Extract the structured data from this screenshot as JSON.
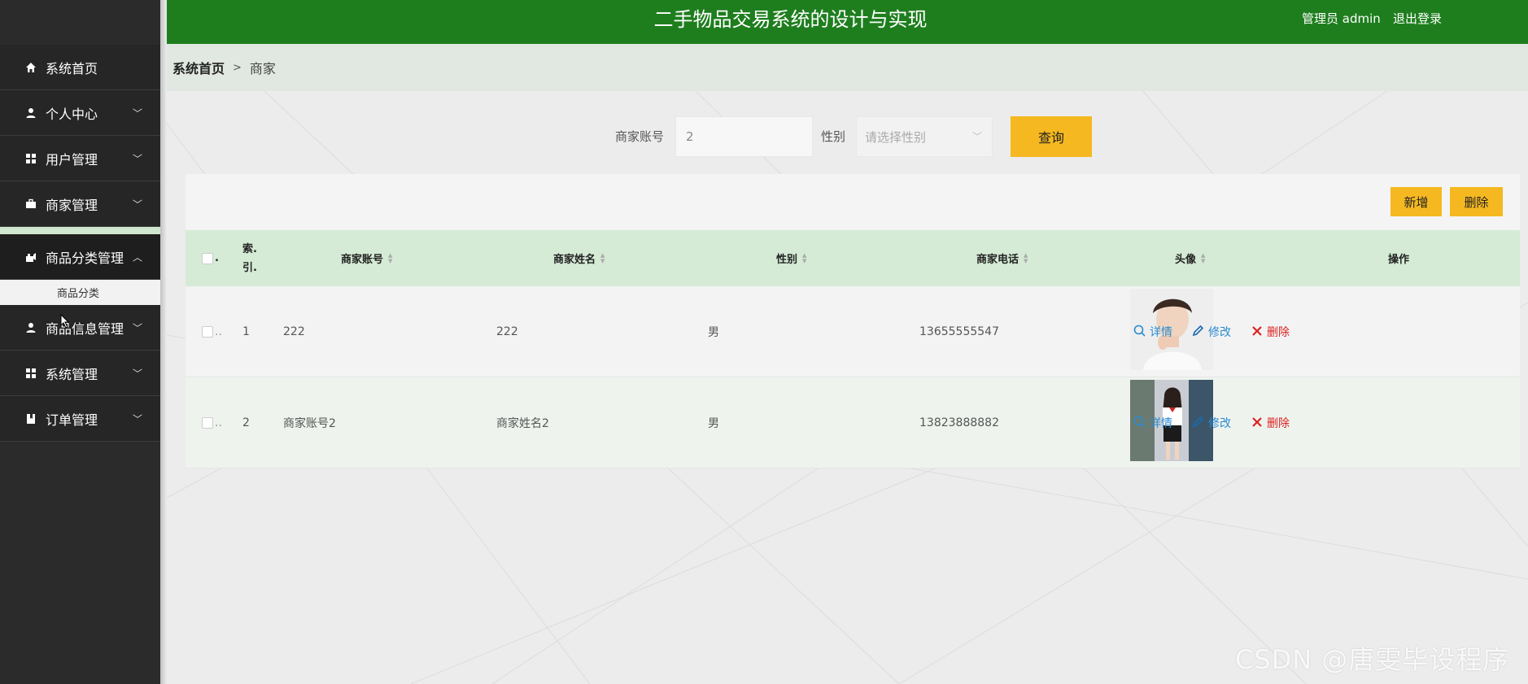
{
  "header": {
    "title": "二手物品交易系统的设计与实现",
    "user": "管理员 admin",
    "logout": "退出登录"
  },
  "sidebar": {
    "items": [
      {
        "label": "系统首页",
        "icon": "home-icon"
      },
      {
        "label": "个人中心",
        "icon": "user-icon"
      },
      {
        "label": "用户管理",
        "icon": "grid-icon"
      },
      {
        "label": "商家管理",
        "icon": "briefcase-icon"
      },
      {
        "label": "商品分类管理",
        "icon": "category-icon"
      },
      {
        "label": "商品信息管理",
        "icon": "user-icon"
      },
      {
        "label": "系统管理",
        "icon": "grid-icon"
      },
      {
        "label": "订单管理",
        "icon": "bookmark-icon"
      }
    ],
    "submenu_label": "商品分类"
  },
  "breadcrumb": {
    "home": "系统首页",
    "separator": ">",
    "current": "商家"
  },
  "search": {
    "account_label": "商家账号",
    "account_value": "2",
    "gender_label": "性别",
    "gender_placeholder": "请选择性别",
    "query_button": "查询"
  },
  "toolbar": {
    "add_label": "新增",
    "delete_label": "删除"
  },
  "table": {
    "columns": {
      "index": "索.\n引.",
      "account": "商家账号",
      "name": "商家姓名",
      "gender": "性别",
      "phone": "商家电话",
      "avatar": "头像",
      "actions": "操作"
    },
    "rows": [
      {
        "index": "1",
        "account": "222",
        "name": "222",
        "gender": "男",
        "phone": "13655555547"
      },
      {
        "index": "2",
        "account": "商家账号2",
        "name": "商家姓名2",
        "gender": "男",
        "phone": "13823888882"
      }
    ],
    "actions": {
      "detail": "详情",
      "edit": "修改",
      "remove": "删除"
    }
  },
  "watermark": "CSDN @唐雯毕设程序",
  "colors": {
    "header": "#1e7e1e",
    "sidebar": "#2b2b2b",
    "accent": "#f5b820",
    "table_header": "#d5ebd5"
  }
}
